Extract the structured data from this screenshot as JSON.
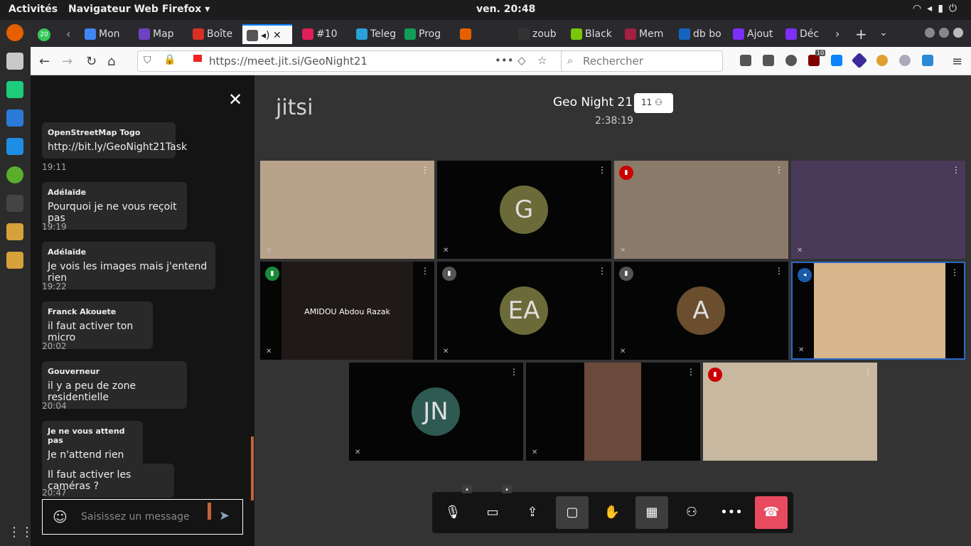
{
  "topbar": {
    "activities": "Activités",
    "app_name": "Navigateur Web Firefox ▾",
    "clock": "ven. 20:48",
    "tray_icons": [
      "wifi-icon",
      "volume-icon",
      "battery-icon",
      "power-icon"
    ]
  },
  "dock": {
    "apps": [
      "firefox",
      "files-cabinet",
      "pycharm",
      "document-editor",
      "vscode",
      "qgis",
      "terminal",
      "josm",
      "josm-2"
    ],
    "grid": "show-apps"
  },
  "tabs": [
    {
      "label": "Mon",
      "color": "#4285f4"
    },
    {
      "label": "Map",
      "color": "#6f42c1"
    },
    {
      "label": "Boîte",
      "color": "#d93025"
    },
    {
      "label": "",
      "color": "#555555"
    },
    {
      "label": "#10",
      "color": "#e01e5a"
    },
    {
      "label": "Teleg",
      "color": "#2aa1da"
    },
    {
      "label": "Prog",
      "color": "#0f9d58"
    },
    {
      "label": "",
      "color": "#e66000"
    },
    {
      "label": "zoub",
      "color": "#333333"
    },
    {
      "label": "Black",
      "color": "#7ac70c"
    },
    {
      "label": "Mem",
      "color": "#a3203e"
    },
    {
      "label": "db bo",
      "color": "#1565c0"
    },
    {
      "label": "Ajout",
      "color": "#7b2ff7"
    },
    {
      "label": "Déc",
      "color": "#7b2ff7"
    }
  ],
  "tab_badge": "20",
  "url": "https://meet.jit.si/GeoNight21",
  "search_placeholder": "Rechercher",
  "ublock_count": "10",
  "chat": {
    "messages": [
      {
        "who": "OpenStreetMap Togo",
        "text": "http://bit.ly/GeoNight21Task",
        "time": "19:11"
      },
      {
        "who": "Adélaïde",
        "text": "Pourquoi je ne vous reçoit pas",
        "time": "19:19"
      },
      {
        "who": "Adélaïde",
        "text": "Je vois les images mais j'entend rien",
        "time": "19:22"
      },
      {
        "who": "Franck Akouete",
        "text": "il faut activer ton micro",
        "time": "20:02"
      },
      {
        "who": "Gouverneur",
        "text": "il y a peu de zone residentielle",
        "time": "20:04"
      },
      {
        "who": "Je ne vous attend pas",
        "text": "Je n'attend rien",
        "time": ""
      },
      {
        "who": "",
        "text": "Il faut activer les caméras ?",
        "time": "20:47"
      }
    ],
    "input_placeholder": "Saisissez un message"
  },
  "conference": {
    "logo": "jitsi",
    "title": "Geo Night 21",
    "participants": "11",
    "timer": "2:38:19"
  },
  "tiles": [
    {
      "initials": "",
      "name": "",
      "color": "#000000"
    },
    {
      "initials": "G",
      "name": "",
      "color": "#6b6b3a"
    },
    {
      "initials": "",
      "name": "",
      "color": "#000000"
    },
    {
      "initials": "",
      "name": "",
      "color": "#000000"
    },
    {
      "initials": "",
      "name": "AMIDOU Abdou Razak",
      "color": "#000000"
    },
    {
      "initials": "EA",
      "name": "",
      "color": "#6b6b3a"
    },
    {
      "initials": "A",
      "name": "",
      "color": "#6a4e2e"
    },
    {
      "initials": "",
      "name": "",
      "color": "#000000"
    },
    {
      "initials": "JN",
      "name": "",
      "color": "#2e5a52"
    },
    {
      "initials": "",
      "name": "",
      "color": "#000000"
    },
    {
      "initials": "",
      "name": "",
      "color": "#000000"
    }
  ],
  "toolbar": [
    "mic-muted",
    "camera",
    "share-screen",
    "chat",
    "raise-hand",
    "tile-view",
    "invite",
    "more",
    "hangup"
  ]
}
